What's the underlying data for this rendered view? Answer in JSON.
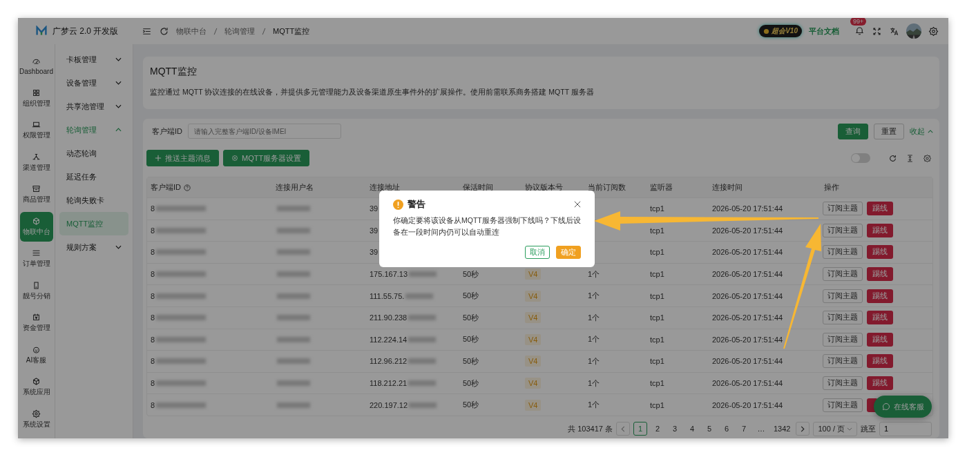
{
  "app": {
    "title": "广梦云 2.0 开发版"
  },
  "rail": [
    {
      "label": "Dashboard",
      "selected": false
    },
    {
      "label": "组织管理",
      "selected": false
    },
    {
      "label": "权限管理",
      "selected": false
    },
    {
      "label": "渠道管理",
      "selected": false
    },
    {
      "label": "商品管理",
      "selected": false
    },
    {
      "label": "物联中台",
      "selected": true
    },
    {
      "label": "订单管理",
      "selected": false
    },
    {
      "label": "靓号分销",
      "selected": false
    },
    {
      "label": "资金管理",
      "selected": false
    },
    {
      "label": "AI客服",
      "selected": false
    },
    {
      "label": "系统应用",
      "selected": false
    },
    {
      "label": "系统设置",
      "selected": false
    }
  ],
  "submenu": [
    {
      "label": "卡板管理",
      "expanded": false
    },
    {
      "label": "设备管理",
      "expanded": false
    },
    {
      "label": "共享池管理",
      "expanded": false
    },
    {
      "label": "轮询管理",
      "expanded": true,
      "children": [
        {
          "label": "动态轮询",
          "selected": false
        },
        {
          "label": "延迟任务",
          "selected": false
        },
        {
          "label": "轮询失败卡",
          "selected": false
        },
        {
          "label": "MQTT监控",
          "selected": true
        }
      ]
    },
    {
      "label": "规则方案",
      "expanded": false
    }
  ],
  "breadcrumb": [
    "物联中台",
    "轮询管理",
    "MQTT监控"
  ],
  "header": {
    "vip": "超会V10",
    "docs": "平台文档",
    "notifications": "99+"
  },
  "page": {
    "title": "MQTT监控",
    "description": "监控通过 MQTT 协议连接的在线设备，并提供多元管理能力及设备渠道原生事件外的扩展操作。使用前需联系商务搭建 MQTT 服务器"
  },
  "filter": {
    "label": "客户端ID",
    "placeholder": "请输入完整客户端ID/设备IMEI",
    "search": "查询",
    "reset": "重置",
    "collapse": "收起"
  },
  "actions": [
    {
      "label": "推送主题消息",
      "kind": "add"
    },
    {
      "label": "MQTT服务器设置",
      "kind": "settings"
    }
  ],
  "toolbar": {
    "auto_refresh": false
  },
  "table": {
    "columns": [
      "客户端ID",
      "连接用户名",
      "连接地址",
      "保活时间",
      "协议版本号",
      "当前订阅数",
      "监听器",
      "连接时间",
      "操作"
    ],
    "rows": [
      {
        "client_id": "8",
        "address": "39",
        "listener": "tcp1",
        "connected_at": "2026-05-20 17:51:44",
        "subscribe": "订阅主题",
        "kick": "踢线"
      },
      {
        "client_id": "8",
        "address": "39",
        "listener": "tcp1",
        "connected_at": "2026-05-20 17:51:44",
        "subscribe": "订阅主题",
        "kick": "踢线"
      },
      {
        "client_id": "8",
        "address": "39",
        "listener": "tcp1",
        "connected_at": "2026-05-20 17:51:44",
        "subscribe": "订阅主题",
        "kick": "踢线"
      },
      {
        "client_id": "8",
        "address": "175.167.13",
        "keep_alive": "50秒",
        "version": "V4",
        "subscriptions": "1个",
        "listener": "tcp1",
        "connected_at": "2026-05-20 17:51:44",
        "subscribe": "订阅主题",
        "kick": "踢线"
      },
      {
        "client_id": "8",
        "address": "111.55.75.",
        "keep_alive": "50秒",
        "version": "V4",
        "subscriptions": "1个",
        "listener": "tcp1",
        "connected_at": "2026-05-20 17:51:44",
        "subscribe": "订阅主题",
        "kick": "踢线"
      },
      {
        "client_id": "8",
        "address": "211.90.238",
        "keep_alive": "50秒",
        "version": "V4",
        "subscriptions": "1个",
        "listener": "tcp1",
        "connected_at": "2026-05-20 17:51:44",
        "subscribe": "订阅主题",
        "kick": "踢线"
      },
      {
        "client_id": "8",
        "address": "112.224.14",
        "keep_alive": "50秒",
        "version": "V4",
        "subscriptions": "1个",
        "listener": "tcp1",
        "connected_at": "2026-05-20 17:51:44",
        "subscribe": "订阅主题",
        "kick": "踢线"
      },
      {
        "client_id": "8",
        "address": "112.96.212",
        "keep_alive": "50秒",
        "version": "V4",
        "subscriptions": "1个",
        "listener": "tcp1",
        "connected_at": "2026-05-20 17:51:44",
        "subscribe": "订阅主题",
        "kick": "踢线"
      },
      {
        "client_id": "8",
        "address": "118.212.21",
        "keep_alive": "50秒",
        "version": "V4",
        "subscriptions": "1个",
        "listener": "tcp1",
        "connected_at": "2026-05-20 17:51:44",
        "subscribe": "订阅主题",
        "kick": "踢线"
      },
      {
        "client_id": "8",
        "address": "220.197.12",
        "keep_alive": "50秒",
        "version": "V4",
        "subscriptions": "1个",
        "listener": "tcp1",
        "connected_at": "2026-05-20 17:51:44",
        "subscribe": "订阅主题"
      }
    ]
  },
  "pagination": {
    "total": "共 103417 条",
    "pages": [
      {
        "label": "1",
        "selected": true
      },
      {
        "label": "2",
        "selected": false
      },
      {
        "label": "3",
        "selected": false
      },
      {
        "label": "4",
        "selected": false
      },
      {
        "label": "5",
        "selected": false
      },
      {
        "label": "6",
        "selected": false
      },
      {
        "label": "7",
        "selected": false
      },
      {
        "label": "…",
        "selected": false
      },
      {
        "label": "1342",
        "selected": false
      }
    ],
    "page_size": "100 / 页",
    "jump_label": "跳至",
    "jump_value": "1"
  },
  "chat_button": "在线客服",
  "dialog": {
    "title": "警告",
    "message": "你确定要将该设备从MQTT服务器强制下线吗？下线后设备在一段时间内仍可以自动重连",
    "buttons": [
      {
        "label": "取消",
        "kind": "secondary"
      },
      {
        "label": "确定",
        "kind": "primary"
      }
    ]
  }
}
